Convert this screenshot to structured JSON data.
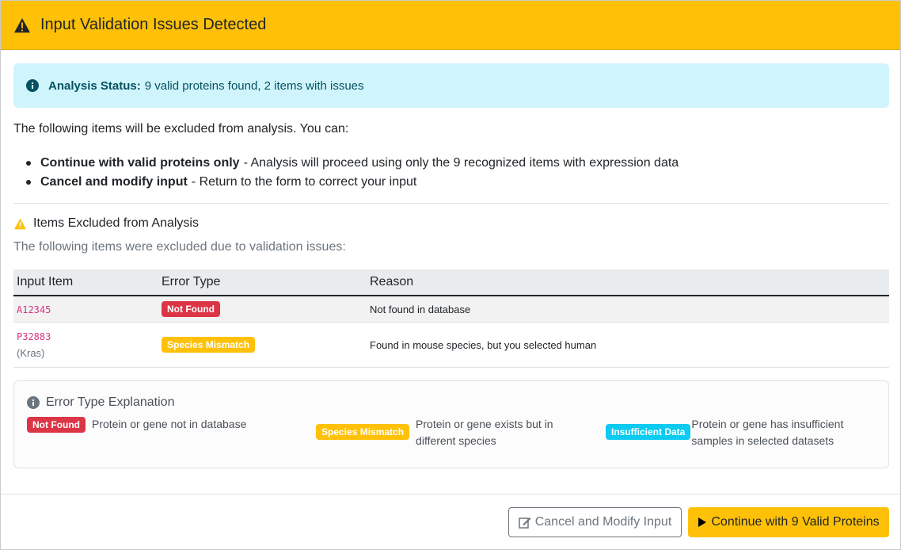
{
  "header": {
    "title": "Input Validation Issues Detected"
  },
  "status": {
    "label": "Analysis Status:",
    "text": "9 valid proteins found, 2 items with issues"
  },
  "intro": "The following items will be excluded from analysis. You can:",
  "options": [
    {
      "title": "Continue with valid proteins only",
      "desc": "- Analysis will proceed using only the 9 recognized items with expression data"
    },
    {
      "title": "Cancel and modify input",
      "desc": "- Return to the form to correct your input"
    }
  ],
  "excluded": {
    "heading": "Items Excluded from Analysis",
    "desc": "The following items were excluded due to validation issues:"
  },
  "table": {
    "headers": [
      "Input Item",
      "Error Type",
      "Reason"
    ],
    "rows": [
      {
        "item": "A12345",
        "sub": "",
        "error": "Not Found",
        "reason": "Not found in database"
      },
      {
        "item": "P32883",
        "sub": "(Kras)",
        "error": "Species Mismatch",
        "reason": "Found in mouse species, but you selected human"
      }
    ]
  },
  "explanation": {
    "heading": "Error Type Explanation",
    "items": [
      {
        "badge": "Not Found",
        "text_line1": "Protein or gene not in database",
        "text_line2": ""
      },
      {
        "badge": "Species Mismatch",
        "text_line1": "Protein or gene exists but in",
        "text_line2": "different species"
      },
      {
        "badge": "Insufficient Data",
        "text_line1": "Protein or gene has insufficient",
        "text_line2": "samples in selected datasets"
      }
    ]
  },
  "buttons": {
    "cancel": "Cancel and Modify Input",
    "continue": "Continue with 9 Valid Proteins"
  },
  "colors": {
    "warning": "#ffc107",
    "danger": "#dc3545",
    "info": "#0dcaf0",
    "alert_bg": "#cff4fc"
  }
}
